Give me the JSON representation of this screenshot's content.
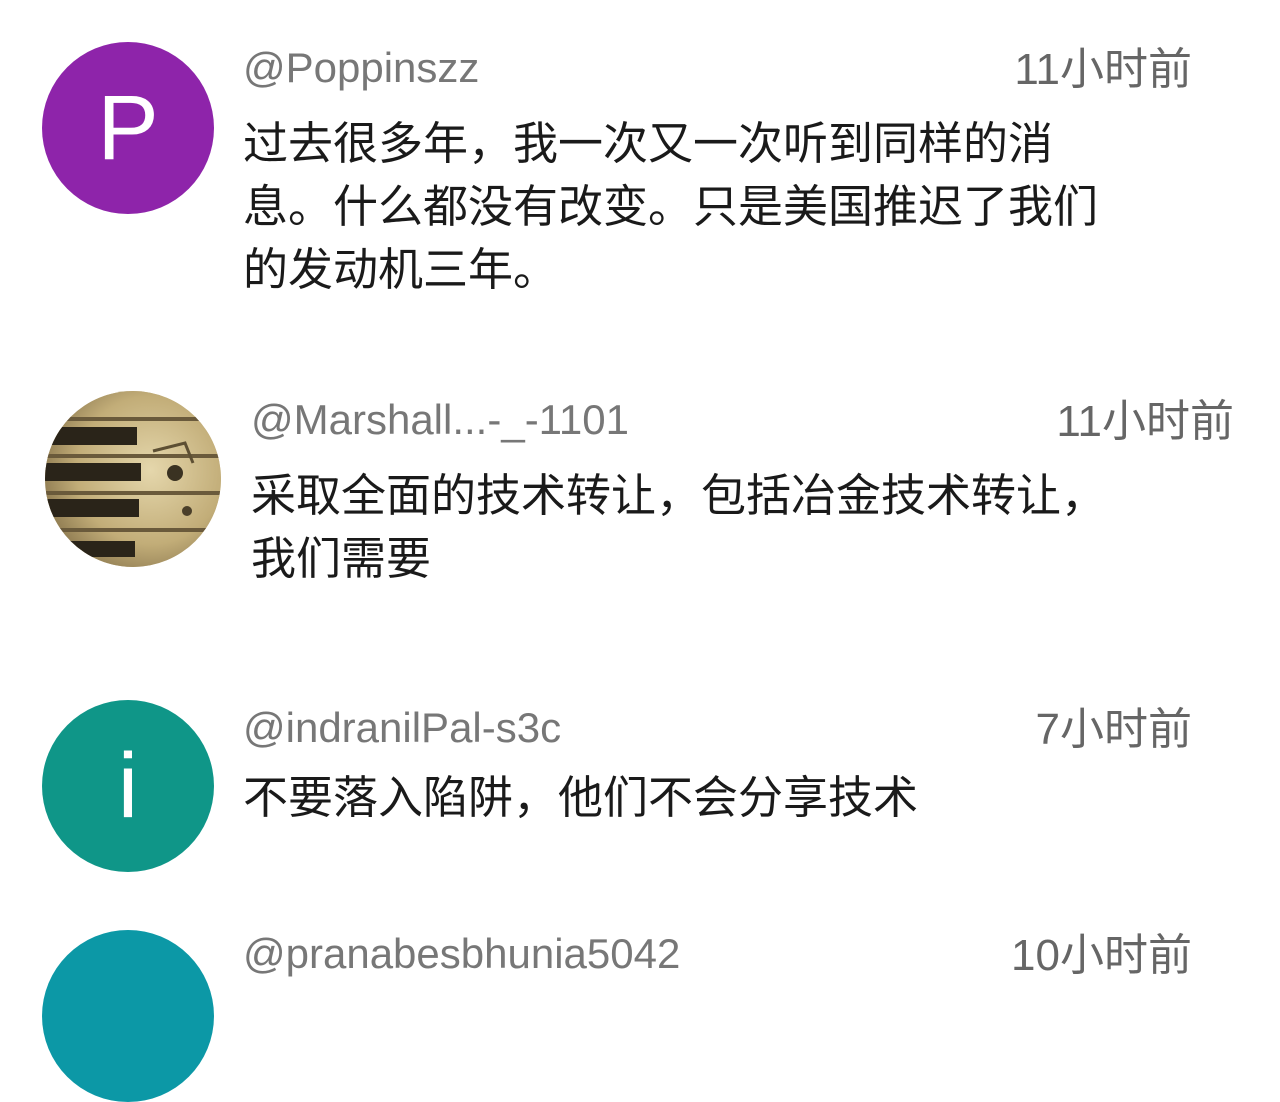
{
  "comments": [
    {
      "handle": "@Poppinszz",
      "time": "11小时前",
      "avatar_letter": "P",
      "avatar_color": "#8e24aa",
      "text": "过去很多年，我一次又一次听到同样的消\n息。什么都没有改变。只是美国推迟了我们\n的发动机三年。"
    },
    {
      "handle": "@Marshall...-_-1101",
      "time": "11小时前",
      "avatar_letter": "",
      "avatar_color": "#c9b98f",
      "text": "采取全面的技术转让，包括冶金技术转让，\n我们需要"
    },
    {
      "handle": "@indranilPal-s3c",
      "time": "7小时前",
      "avatar_letter": "i",
      "avatar_color": "#0f9688",
      "text": "不要落入陷阱，他们不会分享技术"
    },
    {
      "handle": "@pranabesbhunia5042",
      "time": "10小时前",
      "avatar_letter": "",
      "avatar_color": "#0c98a6",
      "text": ""
    }
  ]
}
